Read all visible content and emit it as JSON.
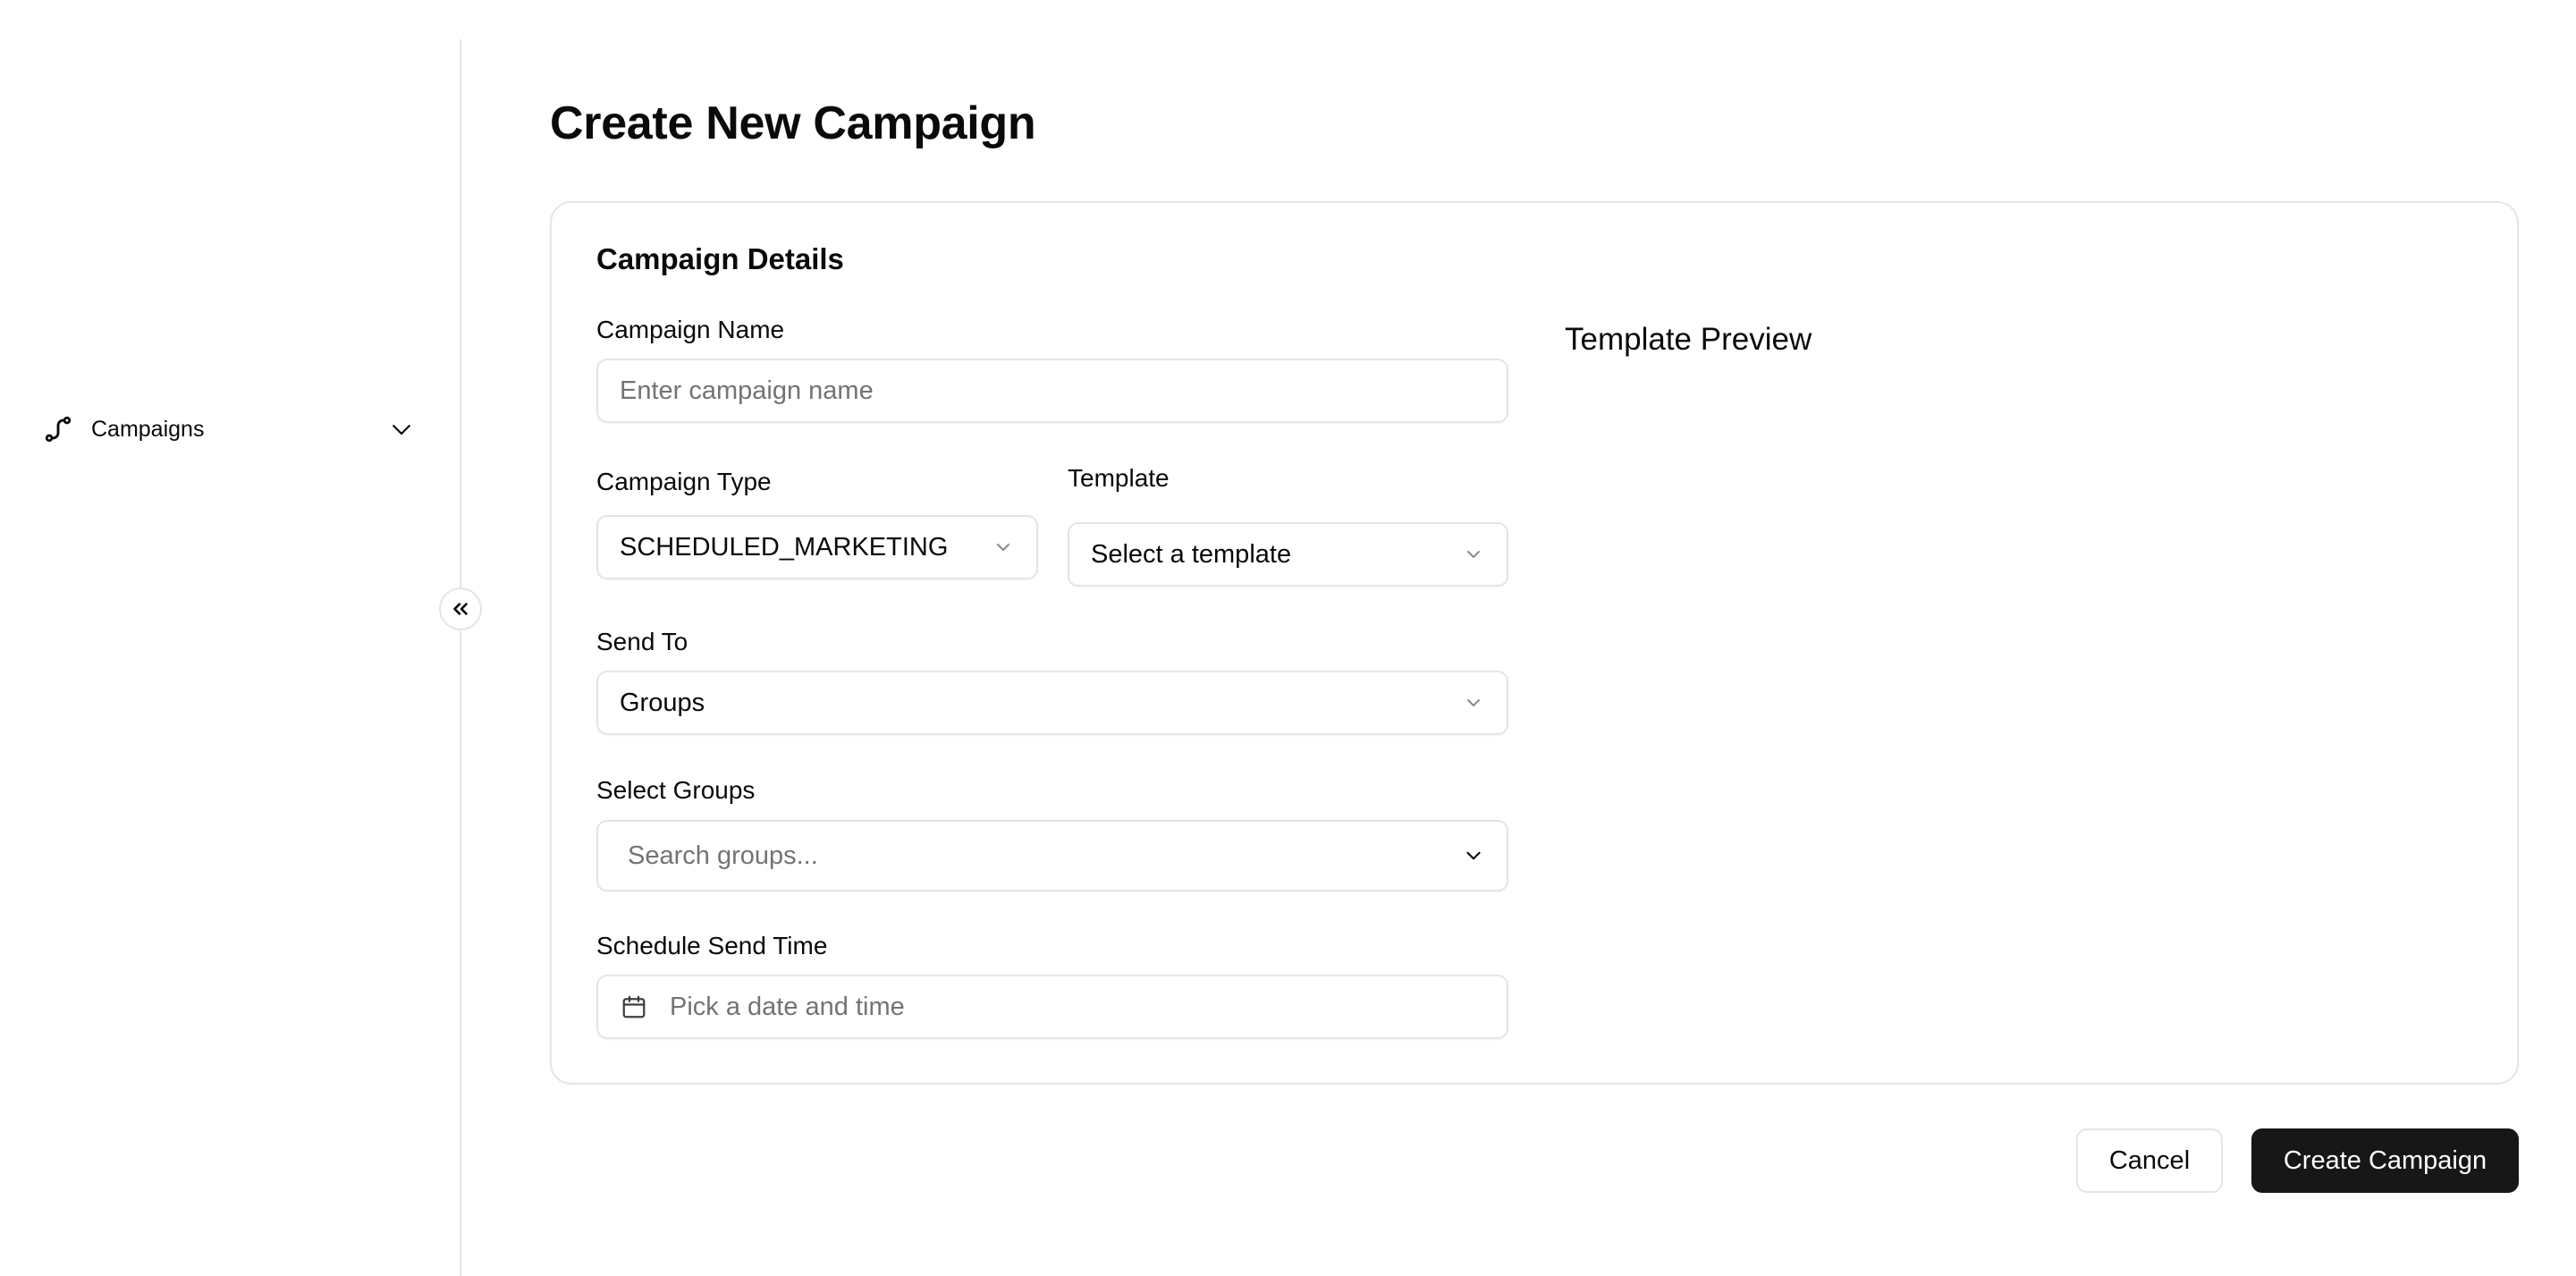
{
  "sidebar": {
    "items": [
      {
        "label": "Campaigns",
        "icon": "route-icon"
      }
    ],
    "collapse_icon": "chevrons-left-icon"
  },
  "page": {
    "title": "Create New Campaign"
  },
  "card": {
    "title": "Campaign Details",
    "campaign_name": {
      "label": "Campaign Name",
      "placeholder": "Enter campaign name",
      "value": ""
    },
    "campaign_type": {
      "label": "Campaign Type",
      "value": "SCHEDULED_MARKETING"
    },
    "template": {
      "label": "Template",
      "placeholder": "Select a template"
    },
    "send_to": {
      "label": "Send To",
      "value": "Groups"
    },
    "select_groups": {
      "label": "Select Groups",
      "placeholder": "Search groups..."
    },
    "schedule": {
      "label": "Schedule Send Time",
      "placeholder": "Pick a date and time"
    },
    "preview": {
      "title": "Template Preview"
    }
  },
  "actions": {
    "cancel_label": "Cancel",
    "create_label": "Create Campaign"
  },
  "colors": {
    "primary_button_bg": "#171717",
    "border": "#e5e5e5",
    "placeholder_text": "#737373"
  }
}
